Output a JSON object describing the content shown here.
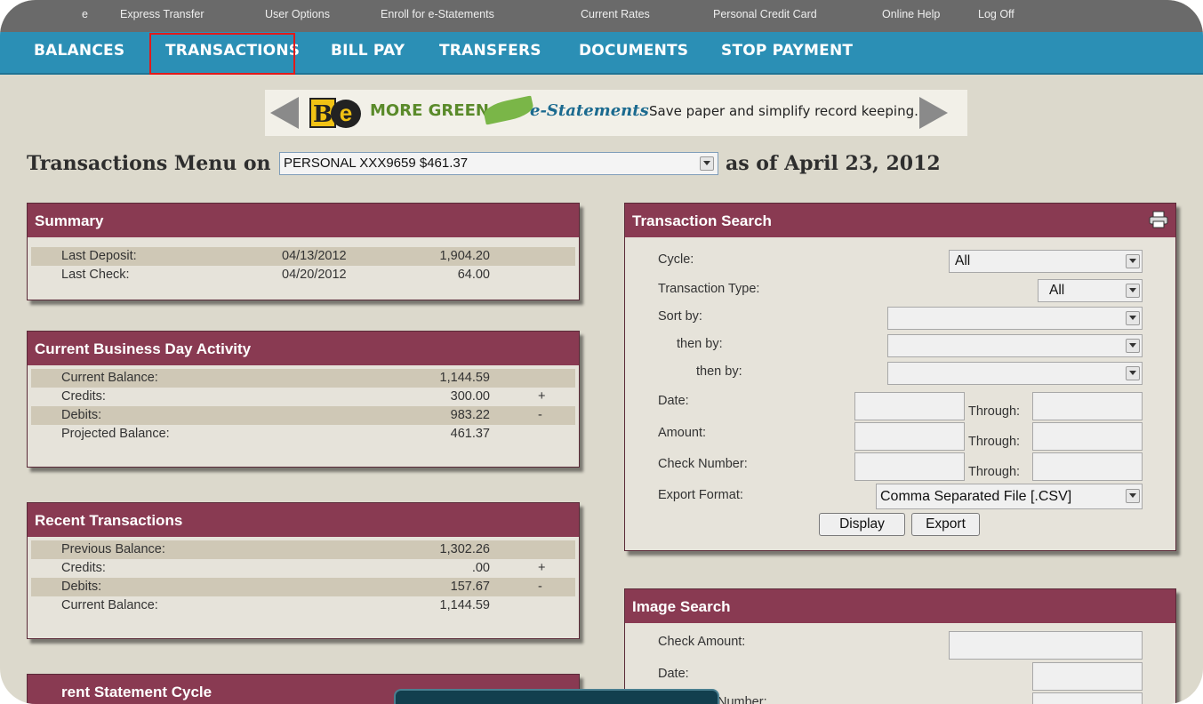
{
  "top_links": [
    "e",
    "Express Transfer",
    "User Options",
    "Enroll for e-Statements",
    "Current Rates",
    "Personal Credit Card",
    "Online Help",
    "Log Off"
  ],
  "nav": [
    "BALANCES",
    "TRANSACTIONS",
    "BILL PAY",
    "TRANSFERS",
    "DOCUMENTS",
    "STOP PAYMENT"
  ],
  "banner": {
    "logo_b": "B",
    "logo_e": "e",
    "more_green": "MORE GREEN",
    "estatements": "e-Statements",
    "tagline": "Save paper and simplify record keeping."
  },
  "header": {
    "title": "Transactions Menu on",
    "account": "PERSONAL XXX9659 $461.37",
    "as_of": "as of April 23, 2012"
  },
  "summary": {
    "title": "Summary",
    "rows": [
      {
        "label": "Last Deposit:",
        "date": "04/13/2012",
        "amount": "1,904.20"
      },
      {
        "label": "Last Check:",
        "date": "04/20/2012",
        "amount": "64.00"
      }
    ]
  },
  "business_day": {
    "title": "Current Business Day Activity",
    "rows": [
      {
        "label": "Current Balance:",
        "amount": "1,144.59",
        "sign": ""
      },
      {
        "label": "Credits:",
        "amount": "300.00",
        "sign": "+"
      },
      {
        "label": "Debits:",
        "amount": "983.22",
        "sign": "-"
      },
      {
        "label": "Projected Balance:",
        "amount": "461.37",
        "sign": ""
      }
    ]
  },
  "recent": {
    "title": "Recent Transactions",
    "rows": [
      {
        "label": "Previous Balance:",
        "amount": "1,302.26",
        "sign": ""
      },
      {
        "label": "Credits:",
        "amount": ".00",
        "sign": "+"
      },
      {
        "label": "Debits:",
        "amount": "157.67",
        "sign": "-"
      },
      {
        "label": "Current Balance:",
        "amount": "1,144.59",
        "sign": ""
      }
    ]
  },
  "statement_cycle": {
    "title": "rent Statement Cycle"
  },
  "search": {
    "title": "Transaction Search",
    "cycle_label": "Cycle:",
    "cycle_value": "All",
    "type_label": "Transaction Type:",
    "type_value": "All",
    "sort_label": "Sort by:",
    "then1_label": "then by:",
    "then2_label": "then by:",
    "date_label": "Date:",
    "amount_label": "Amount:",
    "check_label": "Check Number:",
    "through": "Through:",
    "export_label": "Export Format:",
    "export_value": "Comma Separated File [.CSV]",
    "display_btn": "Display",
    "export_btn": "Export"
  },
  "image_search": {
    "title": "Image Search",
    "check_amount_label": "Check Amount:",
    "date_label": "Date:",
    "number_label": "Number:"
  }
}
